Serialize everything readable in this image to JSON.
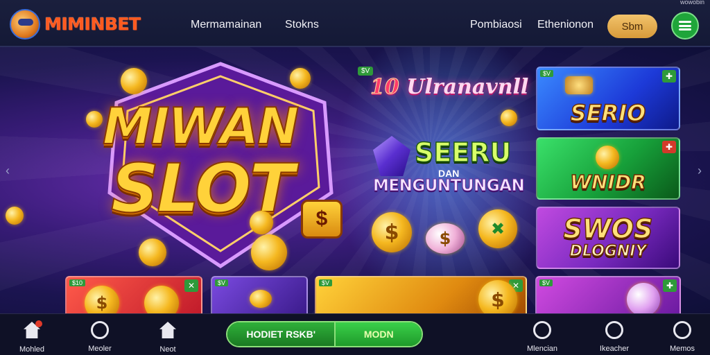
{
  "brand": {
    "name": "MIMINBET"
  },
  "header": {
    "nav_links": [
      "Mermamainan",
      "Stokns",
      "Pombiaosi",
      "Ethenionon"
    ],
    "login_label": "Sbm",
    "corner_text": "wowobin"
  },
  "hero": {
    "title_line1": "MIWAN",
    "title_line2": "SLOT",
    "badge_glyph": "$",
    "promo_tag": "$V",
    "promo_number": "10",
    "promo_script": "Ulranavnll",
    "promo_headline": "SEERU",
    "promo_connector": "DAN",
    "promo_sub": "MENGUNTUNGAN"
  },
  "tiles": [
    {
      "tag": "$V",
      "label": "SERIO",
      "corner": "✚",
      "color": "#1d5ad8"
    },
    {
      "tag": "",
      "label": "WNIDR",
      "corner": "✚",
      "color": "#17a03a"
    },
    {
      "tag": "",
      "label_1": "SWOS",
      "label_2": "DLOGNIY",
      "corner": "",
      "color": "#7a2ac0"
    }
  ],
  "bottom_tiles": [
    {
      "tag": "$10",
      "corner": "✕"
    },
    {
      "tag": "$V",
      "corner": ""
    },
    {
      "tag": "$V",
      "corner": "✕"
    },
    {
      "tag": "$V",
      "corner": "✚"
    }
  ],
  "bottom_nav": {
    "left": [
      "Mohled",
      "Meoler",
      "Neot"
    ],
    "right": [
      "Mlencian",
      "Ikeacher",
      "Memos"
    ],
    "cta_left": "HODIET RSKB'",
    "cta_right": "MODN"
  }
}
